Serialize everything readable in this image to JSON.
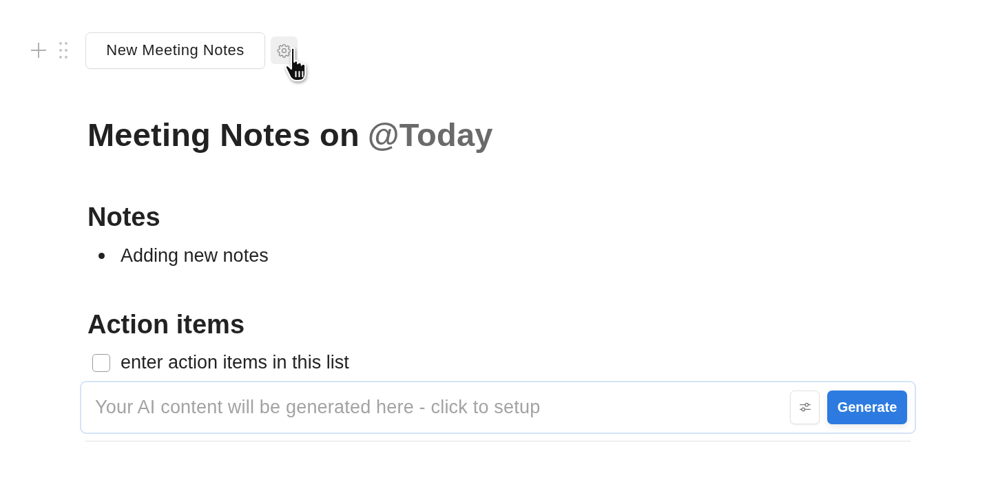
{
  "toolbar": {
    "template_button": "New Meeting Notes"
  },
  "title": {
    "text": "Meeting Notes on",
    "mention": "@Today"
  },
  "sections": [
    {
      "heading": "Notes",
      "items": [
        {
          "kind": "bullet",
          "text": "Adding new notes"
        }
      ]
    },
    {
      "heading": "Action items",
      "items": [
        {
          "kind": "todo",
          "text": "enter action items in this list",
          "checked": false
        }
      ]
    }
  ],
  "ai_block": {
    "prompt_text": "Your AI content will be generated here - click to setup",
    "generate_button": "Generate"
  }
}
